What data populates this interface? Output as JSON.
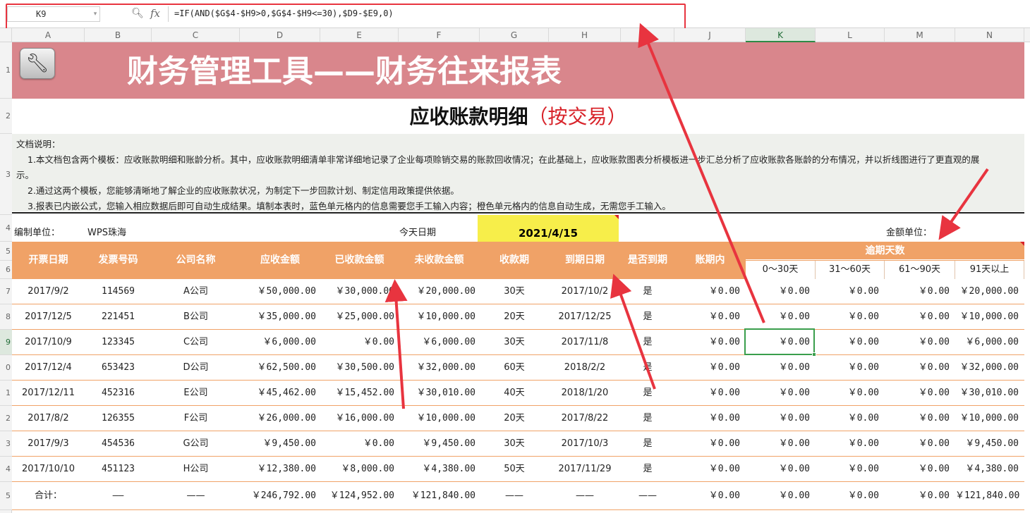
{
  "formula_bar": {
    "cell_ref": "K9",
    "formula": "=IF(AND($G$4-$H9>0,$G$4-$H9<=30),$D9-$E9,0)"
  },
  "columns": [
    "A",
    "B",
    "C",
    "D",
    "E",
    "F",
    "G",
    "H",
    "I",
    "J",
    "K",
    "L",
    "M",
    "N"
  ],
  "rows": [
    "1",
    "2",
    "3",
    "4",
    "5",
    "6",
    "7",
    "8",
    "9",
    "0",
    "1",
    "2",
    "3",
    "4",
    "5"
  ],
  "title": "财务管理工具——财务往来报表",
  "subtitle": "应收账款明细",
  "subtitle_paren": "（按交易）",
  "description": {
    "heading": "文档说明：",
    "line1": "1.本文档包含两个模板：应收账款明细和账龄分析。其中，应收账款明细清单非常详细地记录了企业每项赊销交易的账款回收情况；在此基础上，应收账款图表分析模板进一步汇总分析了应收账款各账龄的分布情况，并以折线图进行了更直观的展",
    "line1b": "示。",
    "line2": "2.通过这两个模板，您能够清晰地了解企业的应收账款状况，为制定下一步回款计划、制定信用政策提供依据。",
    "line3": "3.报表已内嵌公式，您输入相应数据后即可自动生成结果。填制本表时，蓝色单元格内的信息需要您手工输入内容；橙色单元格内的信息自动生成，无需您手工输入。"
  },
  "info": {
    "unit_label": "编制单位：",
    "unit_value": "WPS珠海",
    "today_label": "今天日期",
    "today_value": "2021/4/15",
    "amount_unit_label": "金额单位："
  },
  "table": {
    "headers": [
      "开票日期",
      "发票号码",
      "公司名称",
      "应收金额",
      "已收款金额",
      "未收款金额",
      "收款期",
      "到期日期",
      "是否到期",
      "账期内"
    ],
    "overdue_title": "逾期天数",
    "overdue_sub": [
      "0～30天",
      "31～60天",
      "61～90天",
      "91天以上"
    ],
    "rows": [
      [
        "2017/9/2",
        "114569",
        "A公司",
        "￥50,000.00",
        "￥30,000.00",
        "￥20,000.00",
        "30天",
        "2017/10/2",
        "是",
        "￥0.00",
        "￥0.00",
        "￥0.00",
        "￥0.00",
        "￥20,000.00"
      ],
      [
        "2017/12/5",
        "221451",
        "B公司",
        "￥35,000.00",
        "￥25,000.00",
        "￥10,000.00",
        "20天",
        "2017/12/25",
        "是",
        "￥0.00",
        "￥0.00",
        "￥0.00",
        "￥0.00",
        "￥10,000.00"
      ],
      [
        "2017/10/9",
        "123345",
        "C公司",
        "￥6,000.00",
        "￥0.00",
        "￥6,000.00",
        "30天",
        "2017/11/8",
        "是",
        "￥0.00",
        "￥0.00",
        "￥0.00",
        "￥0.00",
        "￥6,000.00"
      ],
      [
        "2017/12/4",
        "653423",
        "D公司",
        "￥62,500.00",
        "￥30,500.00",
        "￥32,000.00",
        "60天",
        "2018/2/2",
        "是",
        "￥0.00",
        "￥0.00",
        "￥0.00",
        "￥0.00",
        "￥32,000.00"
      ],
      [
        "2017/12/11",
        "452316",
        "E公司",
        "￥45,462.00",
        "￥15,452.00",
        "￥30,010.00",
        "40天",
        "2018/1/20",
        "是",
        "￥0.00",
        "￥0.00",
        "￥0.00",
        "￥0.00",
        "￥30,010.00"
      ],
      [
        "2017/8/2",
        "126355",
        "F公司",
        "￥26,000.00",
        "￥16,000.00",
        "￥10,000.00",
        "20天",
        "2017/8/22",
        "是",
        "￥0.00",
        "￥0.00",
        "￥0.00",
        "￥0.00",
        "￥10,000.00"
      ],
      [
        "2017/9/3",
        "454536",
        "G公司",
        "￥9,450.00",
        "￥0.00",
        "￥9,450.00",
        "30天",
        "2017/10/3",
        "是",
        "￥0.00",
        "￥0.00",
        "￥0.00",
        "￥0.00",
        "￥9,450.00"
      ],
      [
        "2017/10/10",
        "451123",
        "H公司",
        "￥12,380.00",
        "￥8,000.00",
        "￥4,380.00",
        "50天",
        "2017/11/29",
        "是",
        "￥0.00",
        "￥0.00",
        "￥0.00",
        "￥0.00",
        "￥4,380.00"
      ]
    ],
    "total": [
      "合计：",
      "——",
      "——",
      "￥246,792.00",
      "￥124,952.00",
      "￥121,840.00",
      "——",
      "——",
      "——",
      "￥0.00",
      "￥0.00",
      "￥0.00",
      "￥0.00",
      "￥121,840.00"
    ]
  },
  "colors": {
    "title_band": "#d9868c",
    "header_orange": "#f0a267",
    "date_yellow": "#f7ee4a",
    "annotation_red": "#e8343f",
    "selection_green": "#3a9e4c"
  }
}
